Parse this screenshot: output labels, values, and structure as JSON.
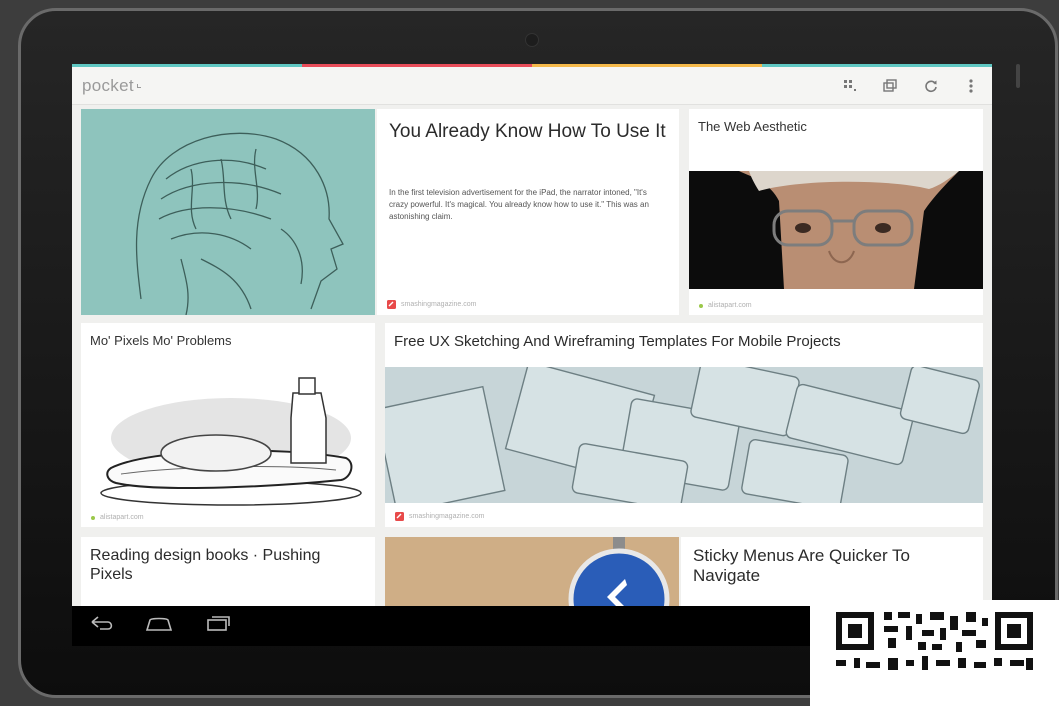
{
  "app": {
    "name": "pocket"
  },
  "colors": {
    "accent": [
      "#5fc7c2",
      "#e94d5a",
      "#f5b94a"
    ],
    "teal_bg": "#8ec4bd"
  },
  "toolbar": {
    "icons": [
      "grid-view-icon",
      "tiles-icon",
      "refresh-icon",
      "overflow-menu-icon"
    ]
  },
  "articles": [
    {
      "title": "You Already Know How To Use It",
      "excerpt": "In the first television advertisement for the iPad, the narrator intoned, \"It's crazy powerful. It's magical. You already know how to use it.\" This was an astonishing claim.",
      "source": "smashingmagazine.com"
    },
    {
      "title": "The Web Aesthetic",
      "source": "alistapart.com"
    },
    {
      "title": "Mo' Pixels Mo' Problems",
      "source": "alistapart.com"
    },
    {
      "title": "Free UX Sketching And Wireframing Templates For Mobile Projects",
      "source": "smashingmagazine.com"
    },
    {
      "title": "Reading design books · Pushing Pixels"
    },
    {
      "title": "Sticky Menus Are Quicker To Navigate"
    }
  ],
  "navbar": {
    "icons": [
      "back-icon",
      "home-icon",
      "recent-apps-icon"
    ]
  }
}
